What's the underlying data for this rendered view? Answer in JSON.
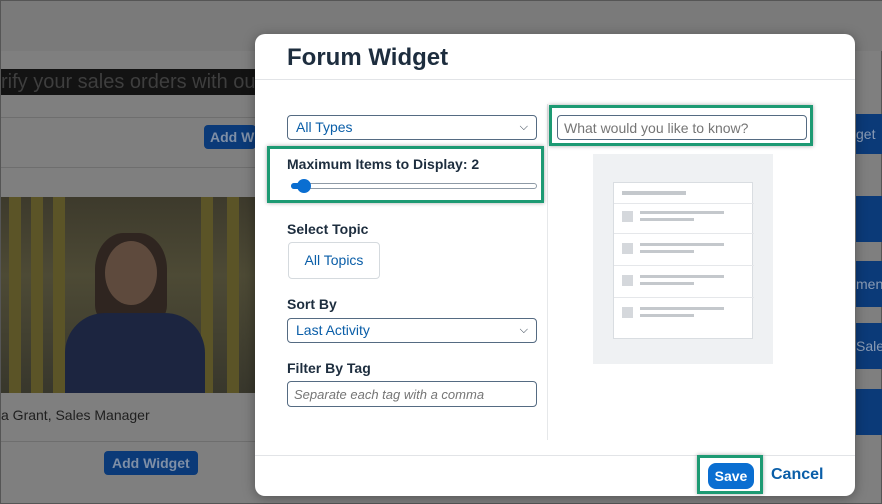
{
  "background": {
    "banner_text": "rify your sales orders with our s",
    "add_widget_partial": "Add Wi",
    "add_widget_label": "Add Widget",
    "right_partial_1": "get",
    "right_partial_2": "ment",
    "right_partial_3": "Sale",
    "photo_caption": "a Grant, Sales Manager"
  },
  "dialog": {
    "title": "Forum Widget",
    "type_select": {
      "value": "All Types",
      "options_visible": [
        "All Types"
      ]
    },
    "max_items": {
      "label": "Maximum Items to Display: 2",
      "value": 2,
      "slider_fraction": 0.02
    },
    "topic": {
      "label": "Select Topic",
      "button": "All Topics"
    },
    "sort": {
      "label": "Sort By",
      "value": "Last Activity"
    },
    "filter": {
      "label": "Filter By Tag",
      "placeholder": "Separate each tag with a comma"
    },
    "search": {
      "placeholder": "What would you like to know?"
    },
    "footer": {
      "save_label": "Save",
      "cancel_label": "Cancel"
    }
  },
  "icons": [
    "chevron-down-icon"
  ],
  "colors": {
    "accent": "#0a6ed1",
    "highlight": "#1d9a73",
    "title": "#1d2d3e",
    "link": "#0a5ea8"
  }
}
